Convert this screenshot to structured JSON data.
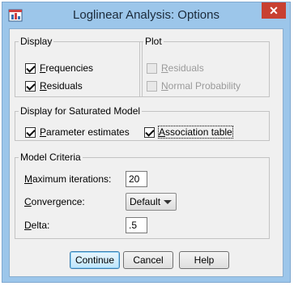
{
  "window": {
    "title": "Loglinear Analysis: Options",
    "close_glyph": "✕"
  },
  "display": {
    "legend": "Display",
    "frequencies": {
      "mnemonic": "F",
      "rest": "requencies",
      "checked": true
    },
    "residuals": {
      "mnemonic": "R",
      "rest": "esiduals",
      "checked": true
    }
  },
  "plot": {
    "legend": "Plot",
    "residuals": {
      "mnemonic": "R",
      "rest": "esiduals",
      "checked": false,
      "enabled": false
    },
    "normal_probability": {
      "mnemonic": "N",
      "rest": "ormal Probability",
      "checked": false,
      "enabled": false
    }
  },
  "saturated": {
    "legend": "Display for Saturated Model",
    "parameter_estimates": {
      "mnemonic": "P",
      "rest": "arameter estimates",
      "checked": true
    },
    "association_table": {
      "mnemonic": "A",
      "rest": "ssociation table",
      "checked": true
    }
  },
  "criteria": {
    "legend": "Model Criteria",
    "max_iter": {
      "mnemonic": "M",
      "rest": "aximum iterations:",
      "value": "20"
    },
    "convergence": {
      "mnemonic": "C",
      "rest": "onvergence:",
      "value": "Default"
    },
    "delta": {
      "mnemonic": "D",
      "rest": "elta:",
      "value": ".5"
    }
  },
  "buttons": {
    "continue": "Continue",
    "cancel": "Cancel",
    "help": "Help"
  },
  "colors": {
    "frame": "#9cc6ea",
    "close": "#c84031",
    "dialog_bg": "#f0f0f0",
    "default_button": "#bee6fd"
  },
  "icons": {
    "app": "spss-dialog-icon",
    "close": "close-icon"
  }
}
